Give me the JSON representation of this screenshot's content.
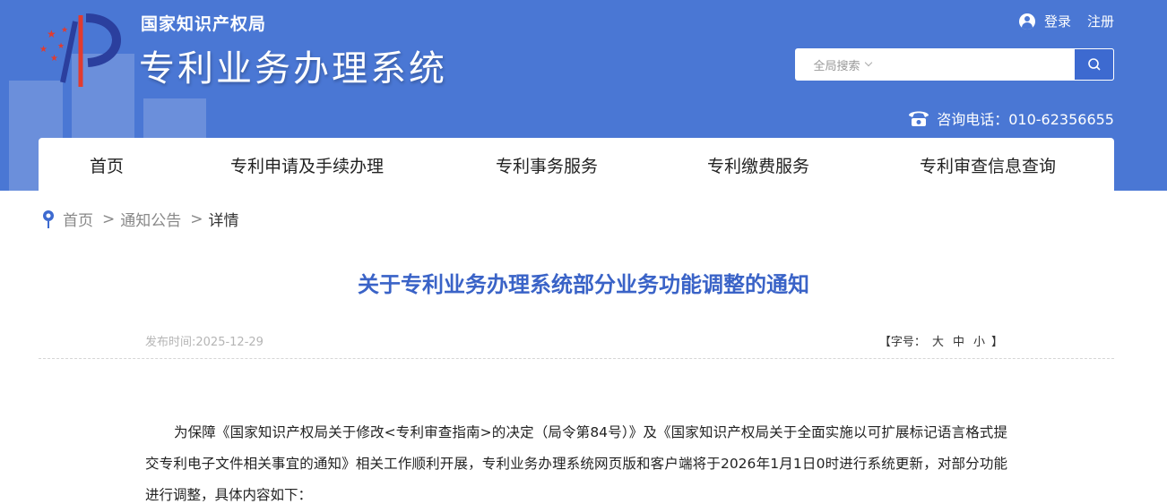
{
  "header": {
    "org_name": "国家知识产权局",
    "system_name": "专利业务办理系统",
    "login_label": "登录",
    "register_label": "注册",
    "search": {
      "scope_label": "全局搜索",
      "placeholder": ""
    },
    "hotline": "咨询电话：010-62356655"
  },
  "nav": {
    "items": [
      {
        "label": "首页"
      },
      {
        "label": "专利申请及手续办理"
      },
      {
        "label": "专利事务服务"
      },
      {
        "label": "专利缴费服务"
      },
      {
        "label": "专利审查信息查询"
      }
    ]
  },
  "breadcrumb": {
    "home": "首页",
    "section": "通知公告",
    "current": "详情",
    "separator": ">"
  },
  "article": {
    "title": "关于专利业务办理系统部分业务功能调整的通知",
    "publish_time": "发布时间:2025-12-29",
    "font_size_prefix": "【字号：",
    "font_large": "大",
    "font_medium": "中",
    "font_small": "小",
    "font_size_suffix": "】",
    "paragraph_1": "为保障《国家知识产权局关于修改<专利审查指南>的决定（局令第84号）》及《国家知识产权局关于全面实施以可扩展标记语言格式提交专利电子文件相关事宜的通知》相关工作顺利开展，专利业务办理系统网页版和客户端将于2026年1月1日0时进行系统更新，对部分功能进行调整，具体内容如下："
  },
  "colors": {
    "header_bg": "#4a77d4",
    "title_blue": "#3a63c7",
    "search_button": "#3d6ad0"
  }
}
